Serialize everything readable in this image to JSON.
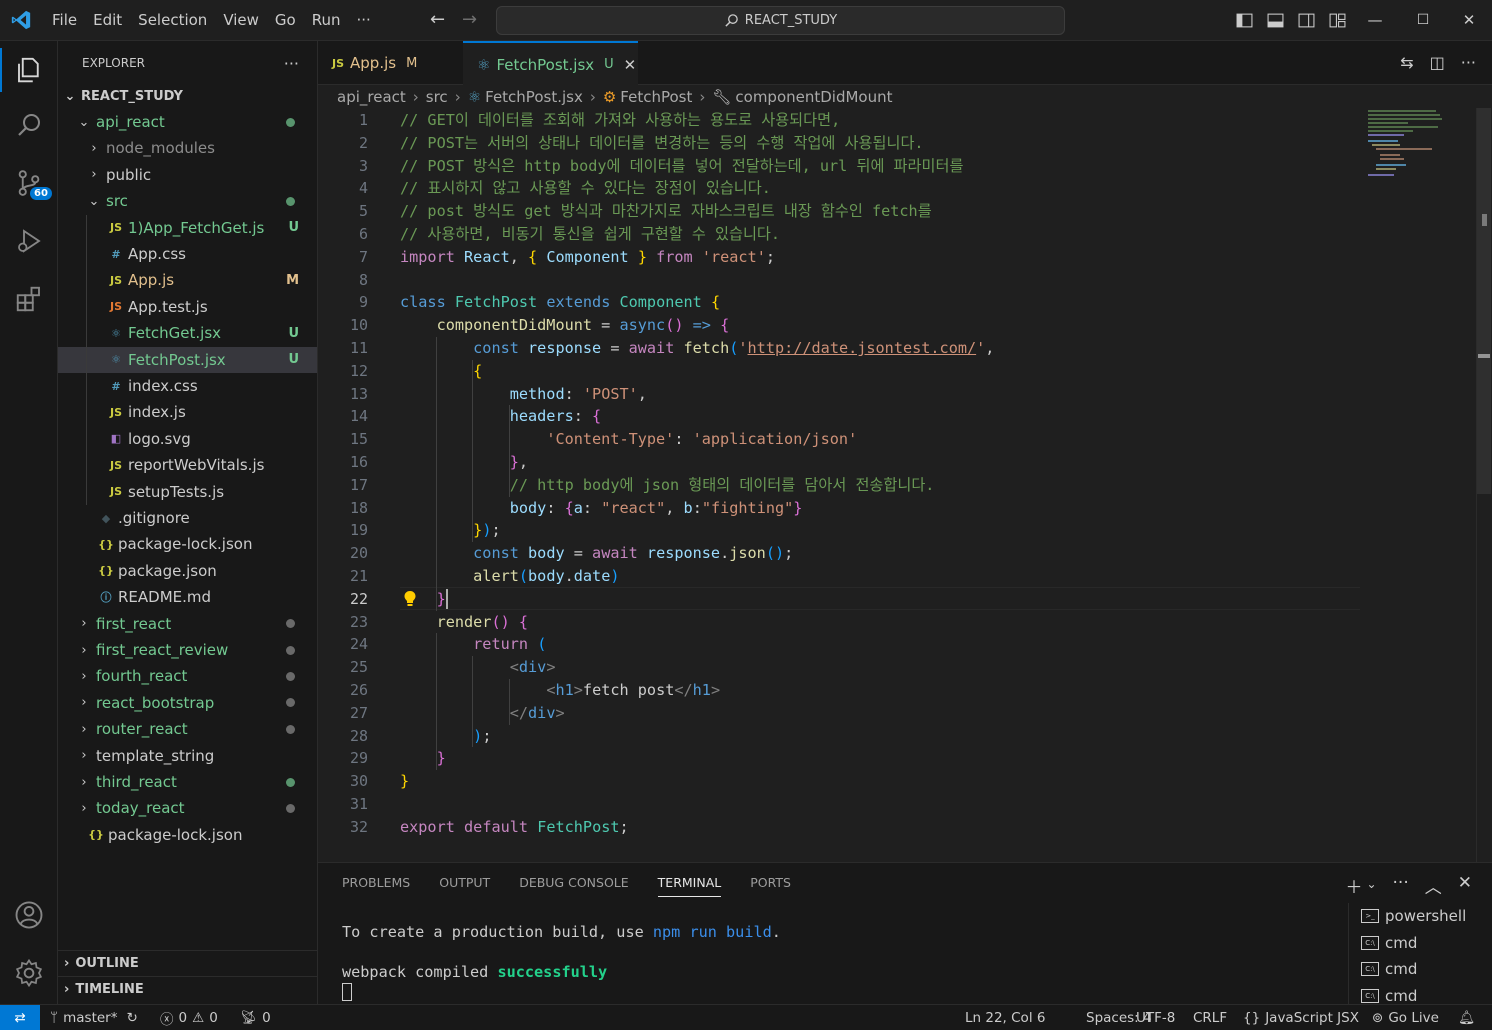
{
  "titlebar": {
    "menus": [
      "File",
      "Edit",
      "Selection",
      "View",
      "Go",
      "Run",
      "···"
    ],
    "search": "REACT_STUDY",
    "icons": [
      "vscode-logo-icon",
      "back-arrow-icon",
      "forward-arrow-icon",
      "search-icon",
      "toggle-sidebar-icon",
      "toggle-panel-icon",
      "toggle-secondary-sidebar-icon",
      "customize-layout-icon",
      "minimize-icon",
      "maximize-icon",
      "close-icon"
    ]
  },
  "activity": {
    "items": [
      "explorer-icon",
      "search-icon",
      "source-control-icon",
      "run-debug-icon",
      "extensions-icon",
      "accounts-icon",
      "manage-gear-icon"
    ],
    "scm_badge": "60"
  },
  "sidebar": {
    "title": "EXPLORER",
    "more": "···",
    "root": "REACT_STUDY",
    "items": [
      {
        "label": "api_react",
        "chev": "⌄",
        "indent": 1,
        "color": "#73c991",
        "dot": "#73c991"
      },
      {
        "label": "node_modules",
        "chev": "›",
        "indent": 2,
        "color": "#8c8c8c"
      },
      {
        "label": "public",
        "chev": "›",
        "indent": 2,
        "color": "#cccccc"
      },
      {
        "label": "src",
        "chev": "⌄",
        "indent": 2,
        "color": "#73c991",
        "dot": "#73c991"
      },
      {
        "label": "1)App_FetchGet.js",
        "icon": "JS",
        "iconColor": "#cbcb41",
        "indent": 3,
        "color": "#73c991",
        "status": "U",
        "statusColor": "#73c991"
      },
      {
        "label": "App.css",
        "icon": "#",
        "iconColor": "#519aba",
        "indent": 3,
        "color": "#cccccc"
      },
      {
        "label": "App.js",
        "icon": "JS",
        "iconColor": "#cbcb41",
        "indent": 3,
        "color": "#e2c08d",
        "status": "M",
        "statusColor": "#e2c08d"
      },
      {
        "label": "App.test.js",
        "icon": "JS",
        "iconColor": "#e37933",
        "indent": 3,
        "color": "#cccccc"
      },
      {
        "label": "FetchGet.jsx",
        "icon": "⚛",
        "iconColor": "#519aba",
        "indent": 3,
        "color": "#73c991",
        "status": "U",
        "statusColor": "#73c991"
      },
      {
        "label": "FetchPost.jsx",
        "icon": "⚛",
        "iconColor": "#519aba",
        "indent": 3,
        "color": "#73c991",
        "status": "U",
        "statusColor": "#73c991",
        "selected": true
      },
      {
        "label": "index.css",
        "icon": "#",
        "iconColor": "#519aba",
        "indent": 3,
        "color": "#cccccc"
      },
      {
        "label": "index.js",
        "icon": "JS",
        "iconColor": "#cbcb41",
        "indent": 3,
        "color": "#cccccc"
      },
      {
        "label": "logo.svg",
        "icon": "◧",
        "iconColor": "#a074c4",
        "indent": 3,
        "color": "#cccccc"
      },
      {
        "label": "reportWebVitals.js",
        "icon": "JS",
        "iconColor": "#cbcb41",
        "indent": 3,
        "color": "#cccccc"
      },
      {
        "label": "setupTests.js",
        "icon": "JS",
        "iconColor": "#cbcb41",
        "indent": 3,
        "color": "#cccccc"
      },
      {
        "label": ".gitignore",
        "icon": "◆",
        "iconColor": "#41535b",
        "indent": 2,
        "color": "#cccccc"
      },
      {
        "label": "package-lock.json",
        "icon": "{}",
        "iconColor": "#cbcb41",
        "indent": 2,
        "color": "#cccccc"
      },
      {
        "label": "package.json",
        "icon": "{}",
        "iconColor": "#cbcb41",
        "indent": 2,
        "color": "#cccccc"
      },
      {
        "label": "README.md",
        "icon": "ⓘ",
        "iconColor": "#519aba",
        "indent": 2,
        "color": "#cccccc"
      },
      {
        "label": "first_react",
        "chev": "›",
        "indent": 1,
        "color": "#73c991",
        "dot": "#8c8c8c"
      },
      {
        "label": "first_react_review",
        "chev": "›",
        "indent": 1,
        "color": "#73c991",
        "dot": "#8c8c8c"
      },
      {
        "label": "fourth_react",
        "chev": "›",
        "indent": 1,
        "color": "#73c991",
        "dot": "#8c8c8c"
      },
      {
        "label": "react_bootstrap",
        "chev": "›",
        "indent": 1,
        "color": "#73c991",
        "dot": "#8c8c8c"
      },
      {
        "label": "router_react",
        "chev": "›",
        "indent": 1,
        "color": "#73c991",
        "dot": "#8c8c8c"
      },
      {
        "label": "template_string",
        "chev": "›",
        "indent": 1,
        "color": "#cccccc"
      },
      {
        "label": "third_react",
        "chev": "›",
        "indent": 1,
        "color": "#73c991",
        "dot": "#73c991"
      },
      {
        "label": "today_react",
        "chev": "›",
        "indent": 1,
        "color": "#73c991",
        "dot": "#8c8c8c"
      },
      {
        "label": "package-lock.json",
        "icon": "{}",
        "iconColor": "#cbcb41",
        "indent": 1,
        "color": "#cccccc"
      }
    ],
    "outline": "OUTLINE",
    "timeline": "TIMELINE"
  },
  "tabs": [
    {
      "icon": "JS",
      "label": "App.js",
      "status": "M",
      "color": "#e2c08d",
      "active": false
    },
    {
      "icon": "⚛",
      "label": "FetchPost.jsx",
      "status": "U",
      "color": "#73c991",
      "active": true,
      "close": "✕"
    }
  ],
  "breadcrumb": [
    "api_react",
    "src",
    "FetchPost.jsx",
    "FetchPost",
    "componentDidMount"
  ],
  "editor": {
    "current_line": 22,
    "lines": [
      [
        [
          "c-com",
          "// GET이 데이터를 조회해 가져와 사용하는 용도로 사용되다면,"
        ]
      ],
      [
        [
          "c-com",
          "// POST는 서버의 상태나 데이터를 변경하는 등의 수행 작업에 사용됩니다."
        ]
      ],
      [
        [
          "c-com",
          "// POST 방식은 http body에 데이터를 넣어 전달하는데, url 뒤에 파라미터를"
        ]
      ],
      [
        [
          "c-com",
          "// 표시하지 않고 사용할 수 있다는 장점이 있습니다."
        ]
      ],
      [
        [
          "c-com",
          "// post 방식도 get 방식과 마찬가지로 자바스크립트 내장 함수인 fetch를"
        ]
      ],
      [
        [
          "c-com",
          "// 사용하면, 비동기 통신을 쉽게 구현할 수 있습니다."
        ]
      ],
      [
        [
          "c-ctl",
          "import"
        ],
        [
          "",
          " "
        ],
        [
          "c-var",
          "React"
        ],
        [
          "",
          ", "
        ],
        [
          "c-b1",
          "{"
        ],
        [
          "",
          " "
        ],
        [
          "c-var",
          "Component"
        ],
        [
          "",
          " "
        ],
        [
          "c-b1",
          "}"
        ],
        [
          "",
          " "
        ],
        [
          "c-ctl",
          "from"
        ],
        [
          "",
          " "
        ],
        [
          "c-str",
          "'react'"
        ],
        [
          "",
          ";"
        ]
      ],
      [],
      [
        [
          "c-kw",
          "class"
        ],
        [
          "",
          " "
        ],
        [
          "c-cls",
          "FetchPost"
        ],
        [
          "",
          " "
        ],
        [
          "c-kw",
          "extends"
        ],
        [
          "",
          " "
        ],
        [
          "c-cls",
          "Component"
        ],
        [
          "",
          " "
        ],
        [
          "c-b1",
          "{"
        ]
      ],
      [
        [
          "",
          "    "
        ],
        [
          "c-fn",
          "componentDidMount"
        ],
        [
          "",
          " = "
        ],
        [
          "c-kw",
          "async"
        ],
        [
          "c-b2",
          "()"
        ],
        [
          "",
          " "
        ],
        [
          "c-kw",
          "=>"
        ],
        [
          "",
          " "
        ],
        [
          "c-b2",
          "{"
        ]
      ],
      [
        [
          "",
          "        "
        ],
        [
          "c-kw",
          "const"
        ],
        [
          "",
          " "
        ],
        [
          "c-var",
          "response"
        ],
        [
          "",
          " = "
        ],
        [
          "c-ctl",
          "await"
        ],
        [
          "",
          " "
        ],
        [
          "c-fn",
          "fetch"
        ],
        [
          "c-b3",
          "("
        ],
        [
          "c-str",
          "'"
        ],
        [
          "c-str link",
          "http://date.jsontest.com/"
        ],
        [
          "c-str",
          "'"
        ],
        [
          "",
          ","
        ]
      ],
      [
        [
          "",
          "        "
        ],
        [
          "c-b1",
          "{"
        ]
      ],
      [
        [
          "",
          "            "
        ],
        [
          "c-var",
          "method"
        ],
        [
          "",
          ": "
        ],
        [
          "c-str",
          "'POST'"
        ],
        [
          "",
          ","
        ]
      ],
      [
        [
          "",
          "            "
        ],
        [
          "c-var",
          "headers"
        ],
        [
          "",
          ": "
        ],
        [
          "c-b2",
          "{"
        ]
      ],
      [
        [
          "",
          "                "
        ],
        [
          "c-str",
          "'Content-Type'"
        ],
        [
          "",
          ": "
        ],
        [
          "c-str",
          "'application/json'"
        ]
      ],
      [
        [
          "",
          "            "
        ],
        [
          "c-b2",
          "}"
        ],
        [
          "",
          ","
        ]
      ],
      [
        [
          "",
          "            "
        ],
        [
          "c-com",
          "// http body에 json 형태의 데이터를 담아서 전송합니다."
        ]
      ],
      [
        [
          "",
          "            "
        ],
        [
          "c-var",
          "body"
        ],
        [
          "",
          ": "
        ],
        [
          "c-b2",
          "{"
        ],
        [
          "c-var",
          "a"
        ],
        [
          "",
          ": "
        ],
        [
          "c-str",
          "\"react\""
        ],
        [
          "",
          ", "
        ],
        [
          "c-var",
          "b"
        ],
        [
          "",
          ":"
        ],
        [
          "c-str",
          "\"fighting\""
        ],
        [
          "c-b2",
          "}"
        ]
      ],
      [
        [
          "",
          "        "
        ],
        [
          "c-b1",
          "}"
        ],
        [
          "c-b3",
          ")"
        ],
        [
          "",
          ";"
        ]
      ],
      [
        [
          "",
          "        "
        ],
        [
          "c-kw",
          "const"
        ],
        [
          "",
          " "
        ],
        [
          "c-var",
          "body"
        ],
        [
          "",
          " = "
        ],
        [
          "c-ctl",
          "await"
        ],
        [
          "",
          " "
        ],
        [
          "c-var",
          "response"
        ],
        [
          "",
          "."
        ],
        [
          "c-fn",
          "json"
        ],
        [
          "c-b3",
          "()"
        ],
        [
          "",
          ";"
        ]
      ],
      [
        [
          "",
          "        "
        ],
        [
          "c-fn",
          "alert"
        ],
        [
          "c-b3",
          "("
        ],
        [
          "c-var",
          "body"
        ],
        [
          "",
          "."
        ],
        [
          "c-var",
          "date"
        ],
        [
          "c-b3",
          ")"
        ]
      ],
      [
        [
          "",
          "    "
        ],
        [
          "c-b2",
          "}"
        ]
      ],
      [
        [
          "",
          "    "
        ],
        [
          "c-fn",
          "render"
        ],
        [
          "c-b2",
          "()"
        ],
        [
          "",
          " "
        ],
        [
          "c-b2",
          "{"
        ]
      ],
      [
        [
          "",
          "        "
        ],
        [
          "c-ctl",
          "return"
        ],
        [
          "",
          " "
        ],
        [
          "c-b3",
          "("
        ]
      ],
      [
        [
          "",
          "            "
        ],
        [
          "c-tag",
          "<"
        ],
        [
          "c-tn",
          "div"
        ],
        [
          "c-tag",
          ">"
        ]
      ],
      [
        [
          "",
          "                "
        ],
        [
          "c-tag",
          "<"
        ],
        [
          "c-tn",
          "h1"
        ],
        [
          "c-tag",
          ">"
        ],
        [
          "",
          "fetch post"
        ],
        [
          "c-tag",
          "</"
        ],
        [
          "c-tn",
          "h1"
        ],
        [
          "c-tag",
          ">"
        ]
      ],
      [
        [
          "",
          "            "
        ],
        [
          "c-tag",
          "</"
        ],
        [
          "c-tn",
          "div"
        ],
        [
          "c-tag",
          ">"
        ]
      ],
      [
        [
          "",
          "        "
        ],
        [
          "c-b3",
          ")"
        ],
        [
          "",
          ";"
        ]
      ],
      [
        [
          "",
          "    "
        ],
        [
          "c-b2",
          "}"
        ]
      ],
      [
        [
          "c-b1",
          "}"
        ]
      ],
      [],
      [
        [
          "c-ctl",
          "export"
        ],
        [
          "",
          " "
        ],
        [
          "c-ctl",
          "default"
        ],
        [
          "",
          " "
        ],
        [
          "c-cls",
          "FetchPost"
        ],
        [
          "",
          ";"
        ]
      ]
    ]
  },
  "panel": {
    "tabs": [
      "PROBLEMS",
      "OUTPUT",
      "DEBUG CONSOLE",
      "TERMINAL",
      "PORTS"
    ],
    "active_tab": "TERMINAL",
    "terminal": {
      "line1_prefix": "To create a production build, use ",
      "line1_cmd": "npm run build",
      "line1_suffix": ".",
      "line2_prefix": "webpack compiled ",
      "line2_status": "successfully"
    },
    "terminals": [
      "powershell",
      "cmd",
      "cmd",
      "cmd"
    ]
  },
  "statusbar": {
    "branch": "master*",
    "errors": "0",
    "warnings": "0",
    "ports": "0",
    "position": "Ln 22, Col 6",
    "spaces": "Spaces: 4",
    "encoding": "UTF-8",
    "eol": "CRLF",
    "language": "JavaScript JSX",
    "golive": "Go Live"
  }
}
